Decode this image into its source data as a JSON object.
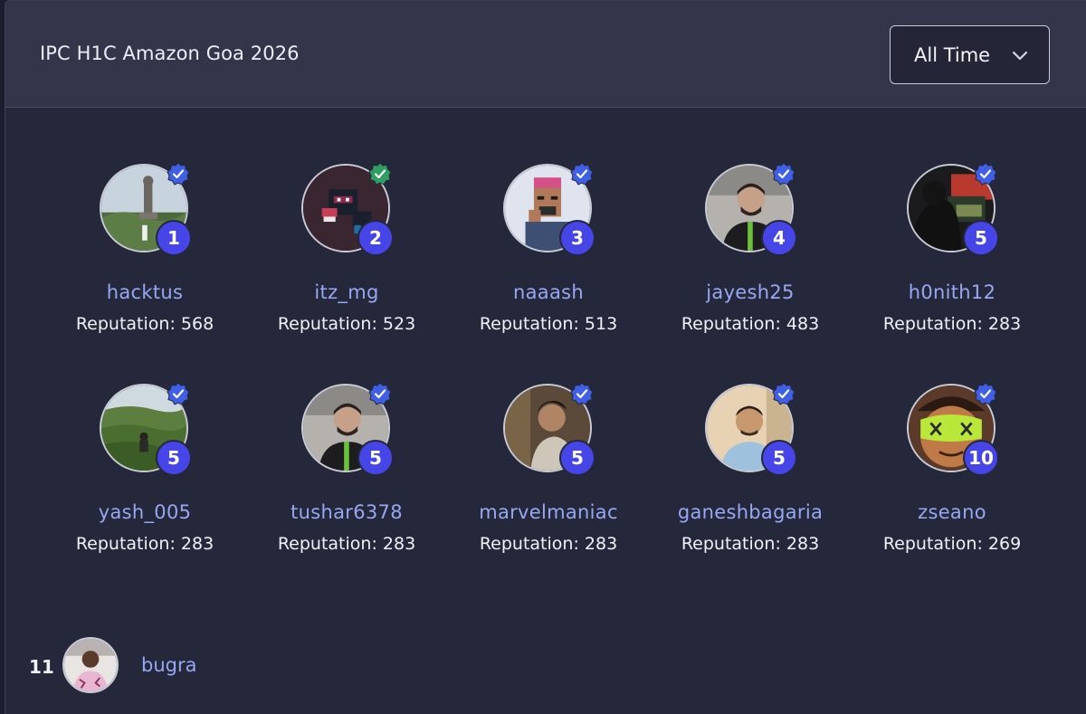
{
  "header": {
    "title": "IPC H1C Amazon Goa 2026",
    "period_select": {
      "selected": "All Time"
    }
  },
  "colors": {
    "rank_badge": "#4645e8",
    "username": "#96a8f2",
    "verified_blue": "#3f5fe6",
    "verified_green": "#2f9e63"
  },
  "top": [
    {
      "rank": "1",
      "username": "hacktus",
      "reputation": "Reputation: 568",
      "verified": "blue",
      "avatar_icon": "statue-landscape-avatar"
    },
    {
      "rank": "2",
      "username": "itz_mg",
      "reputation": "Reputation: 523",
      "verified": "green",
      "avatar_icon": "pixel-ninja-avatar"
    },
    {
      "rank": "3",
      "username": "naaash",
      "reputation": "Reputation: 513",
      "verified": "blue",
      "avatar_icon": "pixel-person-avatar"
    },
    {
      "rank": "4",
      "username": "jayesh25",
      "reputation": "Reputation: 483",
      "verified": "blue",
      "avatar_icon": "person-photo-avatar"
    },
    {
      "rank": "5",
      "username": "h0nith12",
      "reputation": "Reputation: 283",
      "verified": "blue",
      "avatar_icon": "dark-room-avatar"
    },
    {
      "rank": "5",
      "username": "yash_005",
      "reputation": "Reputation: 283",
      "verified": "blue",
      "avatar_icon": "tea-garden-avatar"
    },
    {
      "rank": "5",
      "username": "tushar6378",
      "reputation": "Reputation: 283",
      "verified": "blue",
      "avatar_icon": "person-photo-avatar"
    },
    {
      "rank": "5",
      "username": "marvelmaniac",
      "reputation": "Reputation: 283",
      "verified": "blue",
      "avatar_icon": "person-profile-avatar"
    },
    {
      "rank": "5",
      "username": "ganeshbagaria",
      "reputation": "Reputation: 283",
      "verified": "blue",
      "avatar_icon": "person-selfie-avatar"
    },
    {
      "rank": "10",
      "username": "zseano",
      "reputation": "Reputation: 269",
      "verified": "blue",
      "avatar_icon": "cartoon-goggles-avatar"
    }
  ],
  "list": [
    {
      "rank": "11",
      "username": "bugra",
      "avatar_icon": "person-photo-avatar"
    }
  ]
}
